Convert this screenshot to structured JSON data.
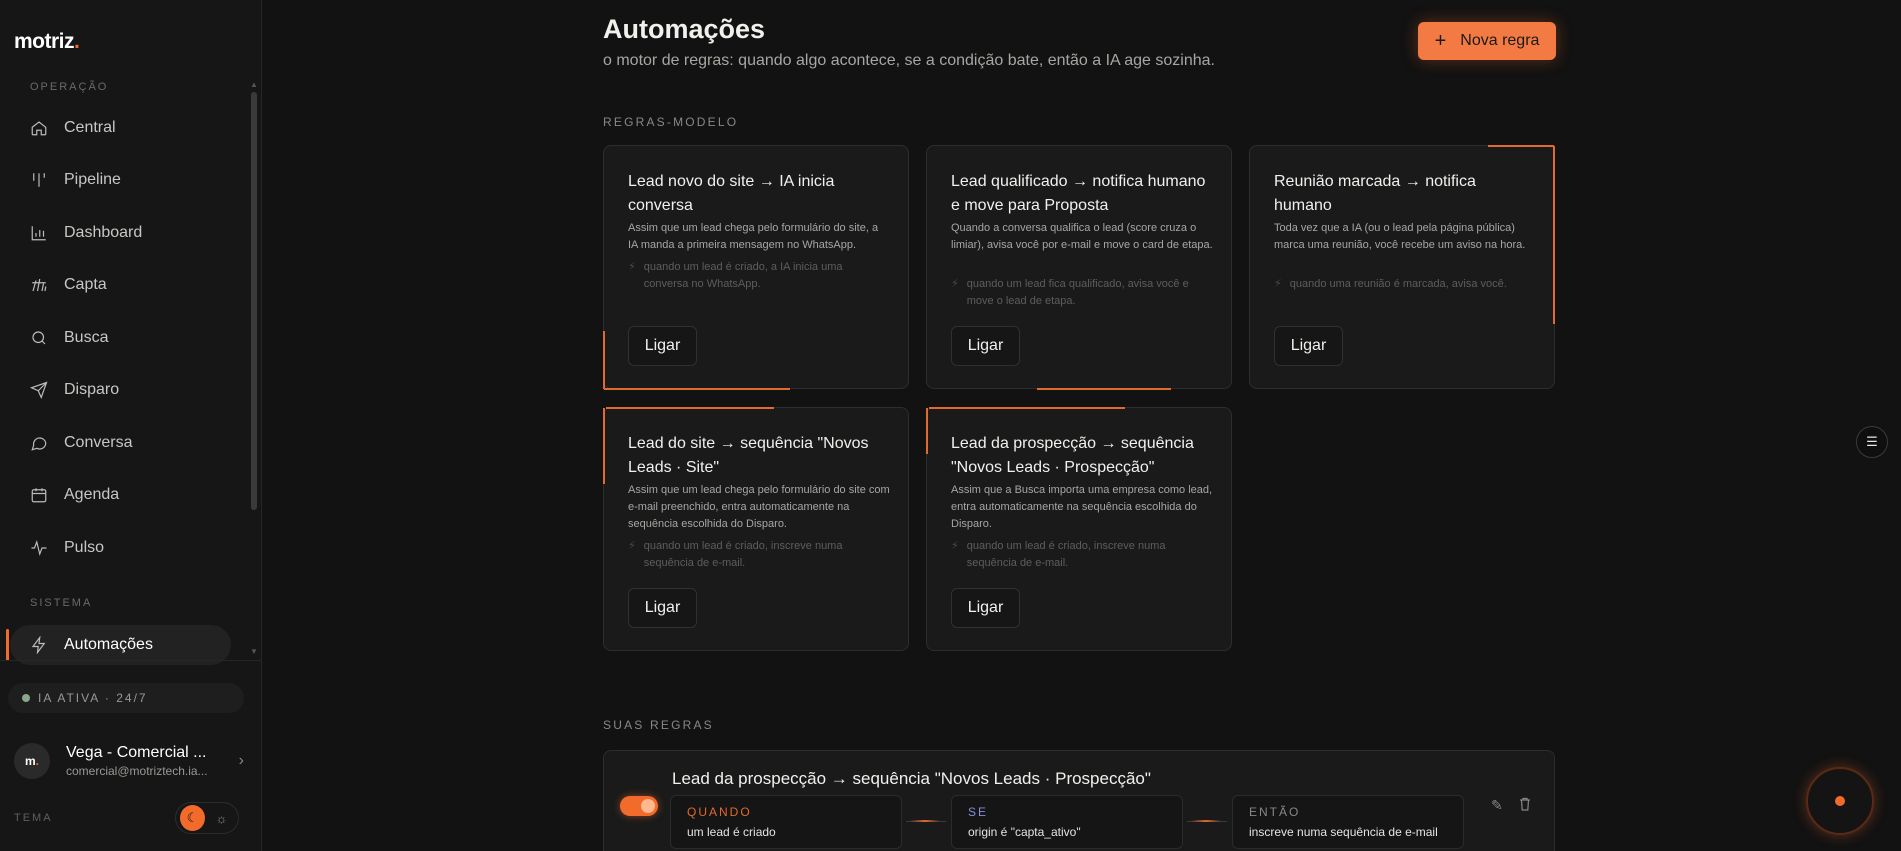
{
  "brand": {
    "name": "motriz",
    "dot": "."
  },
  "sidebar": {
    "section_operacao": "OPERAÇÃO",
    "section_sistema": "SISTEMA",
    "items": [
      {
        "label": "Central",
        "icon": "home-icon"
      },
      {
        "label": "Pipeline",
        "icon": "pipeline-icon"
      },
      {
        "label": "Dashboard",
        "icon": "bar-chart-icon"
      },
      {
        "label": "Capta",
        "icon": "capta-icon"
      },
      {
        "label": "Busca",
        "icon": "search-icon"
      },
      {
        "label": "Disparo",
        "icon": "send-icon"
      },
      {
        "label": "Conversa",
        "icon": "chat-icon"
      },
      {
        "label": "Agenda",
        "icon": "calendar-icon"
      },
      {
        "label": "Pulso",
        "icon": "pulse-icon"
      }
    ],
    "active_item": {
      "label": "Automações",
      "icon": "bolt-icon"
    },
    "ia_status": "IA ATIVA · 24/7",
    "user": {
      "initials": "m",
      "initials_dot": ".",
      "name": "Vega - Comercial ...",
      "email": "comercial@motriztech.ia..."
    },
    "tema_label": "TEMA"
  },
  "header": {
    "title": "Automações",
    "subtitle": "o motor de regras: quando algo acontece, se a condição bate, então a IA age sozinha.",
    "new_button": "Nova regra"
  },
  "templates_label": "REGRAS-MODELO",
  "templates": [
    {
      "title": "Lead novo do site → IA inicia conversa",
      "description": "Assim que um lead chega pelo formulário do site, a IA manda a primeira mensagem no WhatsApp.",
      "trigger": "quando um lead é criado, a IA inicia uma conversa no WhatsApp.",
      "button": "Ligar"
    },
    {
      "title": "Lead qualificado → notifica humano e move para Proposta",
      "description": "Quando a conversa qualifica o lead (score cruza o limiar), avisa você por e-mail e move o card de etapa.",
      "trigger": "quando um lead fica qualificado, avisa você e move o lead de etapa.",
      "button": "Ligar"
    },
    {
      "title": "Reunião marcada → notifica humano",
      "description": "Toda vez que a IA (ou o lead pela página pública) marca uma reunião, você recebe um aviso na hora.",
      "trigger": "quando uma reunião é marcada, avisa você.",
      "button": "Ligar"
    },
    {
      "title": "Lead do site → sequência \"Novos Leads · Site\"",
      "description": "Assim que um lead chega pelo formulário do site com e-mail preenchido, entra automaticamente na sequência escolhida do Disparo.",
      "trigger": "quando um lead é criado, inscreve numa sequência de e-mail.",
      "button": "Ligar"
    },
    {
      "title": "Lead da prospecção → sequência \"Novos Leads · Prospecção\"",
      "description": "Assim que a Busca importa uma empresa como lead, entra automaticamente na sequência escolhida do Disparo.",
      "trigger": "quando um lead é criado, inscreve numa sequência de e-mail.",
      "button": "Ligar"
    }
  ],
  "my_rules_label": "SUAS REGRAS",
  "rules": [
    {
      "title": "Lead da prospecção → sequência \"Novos Leads · Prospecção\"",
      "enabled": true,
      "when_label": "QUANDO",
      "when_value": "um lead é criado",
      "if_label": "SE",
      "if_value": "origin é \"capta_ativo\"",
      "then_label": "ENTÃO",
      "then_value": "inscreve numa sequência de e-mail",
      "edit_icon": "pencil-icon",
      "delete_icon": "trash-icon"
    }
  ],
  "colors": {
    "accent": "#f26b2a",
    "background": "#121212",
    "card": "#1a1a1a",
    "when": "#e06a30",
    "if": "#8a8cd8",
    "then": "#8a8884"
  }
}
